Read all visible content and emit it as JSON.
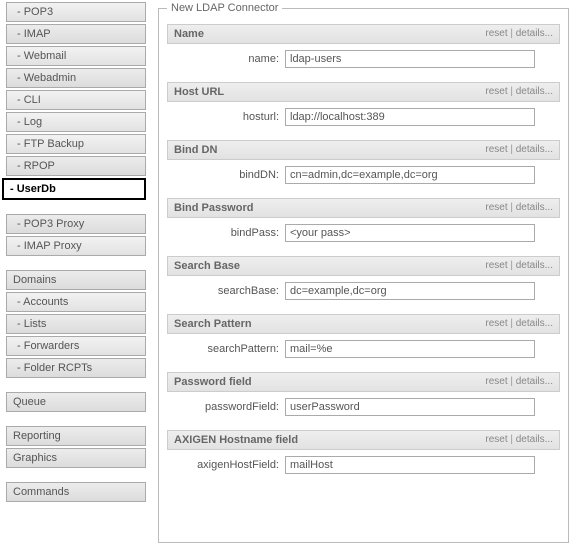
{
  "sidebar": {
    "items": [
      {
        "label": "- POP3",
        "class": "sub"
      },
      {
        "label": "- IMAP",
        "class": "sub alt"
      },
      {
        "label": "- Webmail",
        "class": "sub"
      },
      {
        "label": "- Webadmin",
        "class": "sub alt"
      },
      {
        "label": "- CLI",
        "class": "sub"
      },
      {
        "label": "- Log",
        "class": "sub"
      },
      {
        "label": "- FTP Backup",
        "class": "sub"
      },
      {
        "label": "- RPOP",
        "class": "sub alt"
      },
      {
        "label": "- UserDb",
        "class": "active"
      },
      {
        "gap": true
      },
      {
        "label": "- POP3 Proxy",
        "class": "sub alt"
      },
      {
        "label": "- IMAP Proxy",
        "class": "sub"
      },
      {
        "gap": true
      },
      {
        "label": "Domains",
        "class": "alt"
      },
      {
        "label": "- Accounts",
        "class": "sub"
      },
      {
        "label": "- Lists",
        "class": "sub alt"
      },
      {
        "label": "- Forwarders",
        "class": "sub"
      },
      {
        "label": "- Folder RCPTs",
        "class": "sub alt"
      },
      {
        "gap": true
      },
      {
        "label": "Queue",
        "class": "alt"
      },
      {
        "gap": true
      },
      {
        "label": "Reporting",
        "class": "alt"
      },
      {
        "label": "Graphics",
        "class": "alt"
      },
      {
        "gap": true
      },
      {
        "label": "Commands",
        "class": "alt"
      }
    ]
  },
  "panel": {
    "legend": "New LDAP Connector",
    "reset": "reset",
    "details": "details...",
    "sep": " | "
  },
  "sections": {
    "name": {
      "title": "Name",
      "label": "name:",
      "value": "ldap-users"
    },
    "hosturl": {
      "title": "Host URL",
      "label": "hosturl:",
      "value": "ldap://localhost:389"
    },
    "binddn": {
      "title": "Bind DN",
      "label": "bindDN:",
      "value": "cn=admin,dc=example,dc=org"
    },
    "bindpass": {
      "title": "Bind Password",
      "label": "bindPass:",
      "value": "<your pass>"
    },
    "searchbase": {
      "title": "Search Base",
      "label": "searchBase:",
      "value": "dc=example,dc=org"
    },
    "searchpat": {
      "title": "Search Pattern",
      "label": "searchPattern:",
      "value": "mail=%e"
    },
    "passfield": {
      "title": "Password field",
      "label": "passwordField:",
      "value": "userPassword"
    },
    "hostfield": {
      "title": "AXIGEN Hostname field",
      "label": "axigenHostField:",
      "value": "mailHost"
    }
  }
}
